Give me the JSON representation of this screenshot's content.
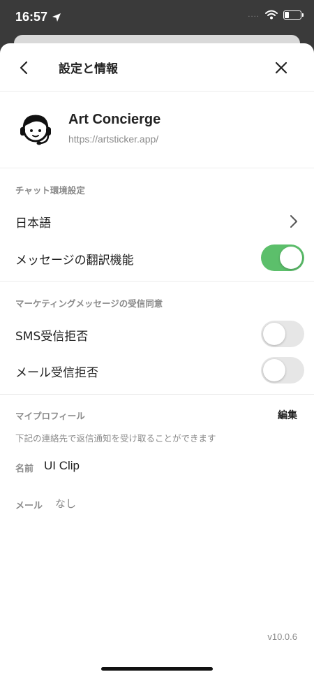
{
  "status_bar": {
    "time": "16:57",
    "signal": "....",
    "location_icon": "location-arrow-icon",
    "wifi_icon": "wifi-icon",
    "battery_icon": "battery-icon"
  },
  "nav": {
    "title": "設定と情報",
    "back_icon": "chevron-left-icon",
    "close_icon": "close-icon"
  },
  "profile": {
    "name": "Art Concierge",
    "url": "https://artsticker.app/",
    "avatar_icon": "concierge-headset-avatar-icon"
  },
  "chat_settings": {
    "header": "チャット環境設定",
    "language_label": "日本語",
    "translation_label": "メッセージの翻訳機能",
    "translation_enabled": true
  },
  "marketing": {
    "header": "マーケティングメッセージの受信同意",
    "sms_label": "SMS受信拒否",
    "sms_enabled": false,
    "mail_label": "メール受信拒否",
    "mail_enabled": false
  },
  "my_profile": {
    "header": "マイプロフィール",
    "edit_label": "編集",
    "description": "下記の連絡先で返信通知を受け取ることができます",
    "name_label": "名前",
    "name_value": "UI Clip",
    "mail_label": "メール",
    "mail_value": "なし"
  },
  "version": "v10.0.6",
  "colors": {
    "toggle_on": "#5cbf6b",
    "toggle_off": "#e6e6e6",
    "muted_text": "#8a8a8a"
  }
}
